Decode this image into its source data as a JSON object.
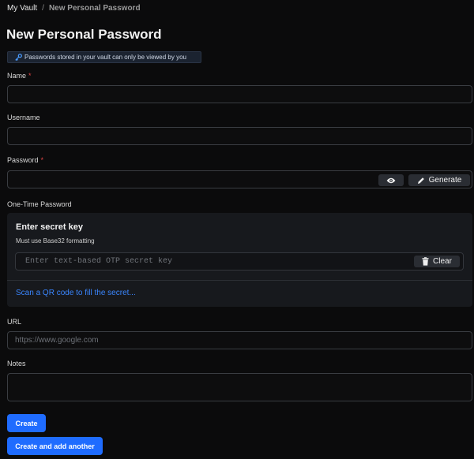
{
  "breadcrumb": {
    "root": "My Vault",
    "separator": "/",
    "current": "New Personal Password"
  },
  "page": {
    "title": "New Personal Password"
  },
  "notice": {
    "icon": "key-icon",
    "text": "Passwords stored in your vault can only be viewed by you"
  },
  "form": {
    "name": {
      "label": "Name",
      "required_mark": "*",
      "value": "",
      "placeholder": ""
    },
    "username": {
      "label": "Username",
      "value": "",
      "placeholder": ""
    },
    "password": {
      "label": "Password",
      "required_mark": "*",
      "value": "",
      "reveal_icon": "eye-icon",
      "generate_icon": "pencil-icon",
      "generate_label": "Generate"
    },
    "otp": {
      "label": "One-Time Password",
      "title": "Enter secret key",
      "subtitle": "Must use Base32 formatting",
      "placeholder": "Enter text-based OTP secret key",
      "value": "",
      "clear_icon": "trash-icon",
      "clear_label": "Clear",
      "qr_link": "Scan a QR code to fill the secret..."
    },
    "url": {
      "label": "URL",
      "placeholder": "https://www.google.com",
      "value": ""
    },
    "notes": {
      "label": "Notes",
      "value": ""
    }
  },
  "actions": {
    "create_label": "Create",
    "create_another_label": "Create and add another"
  },
  "colors": {
    "accent": "#1f6cff",
    "link": "#3a86ff",
    "required": "#e04545",
    "background": "#0b0b0c"
  }
}
